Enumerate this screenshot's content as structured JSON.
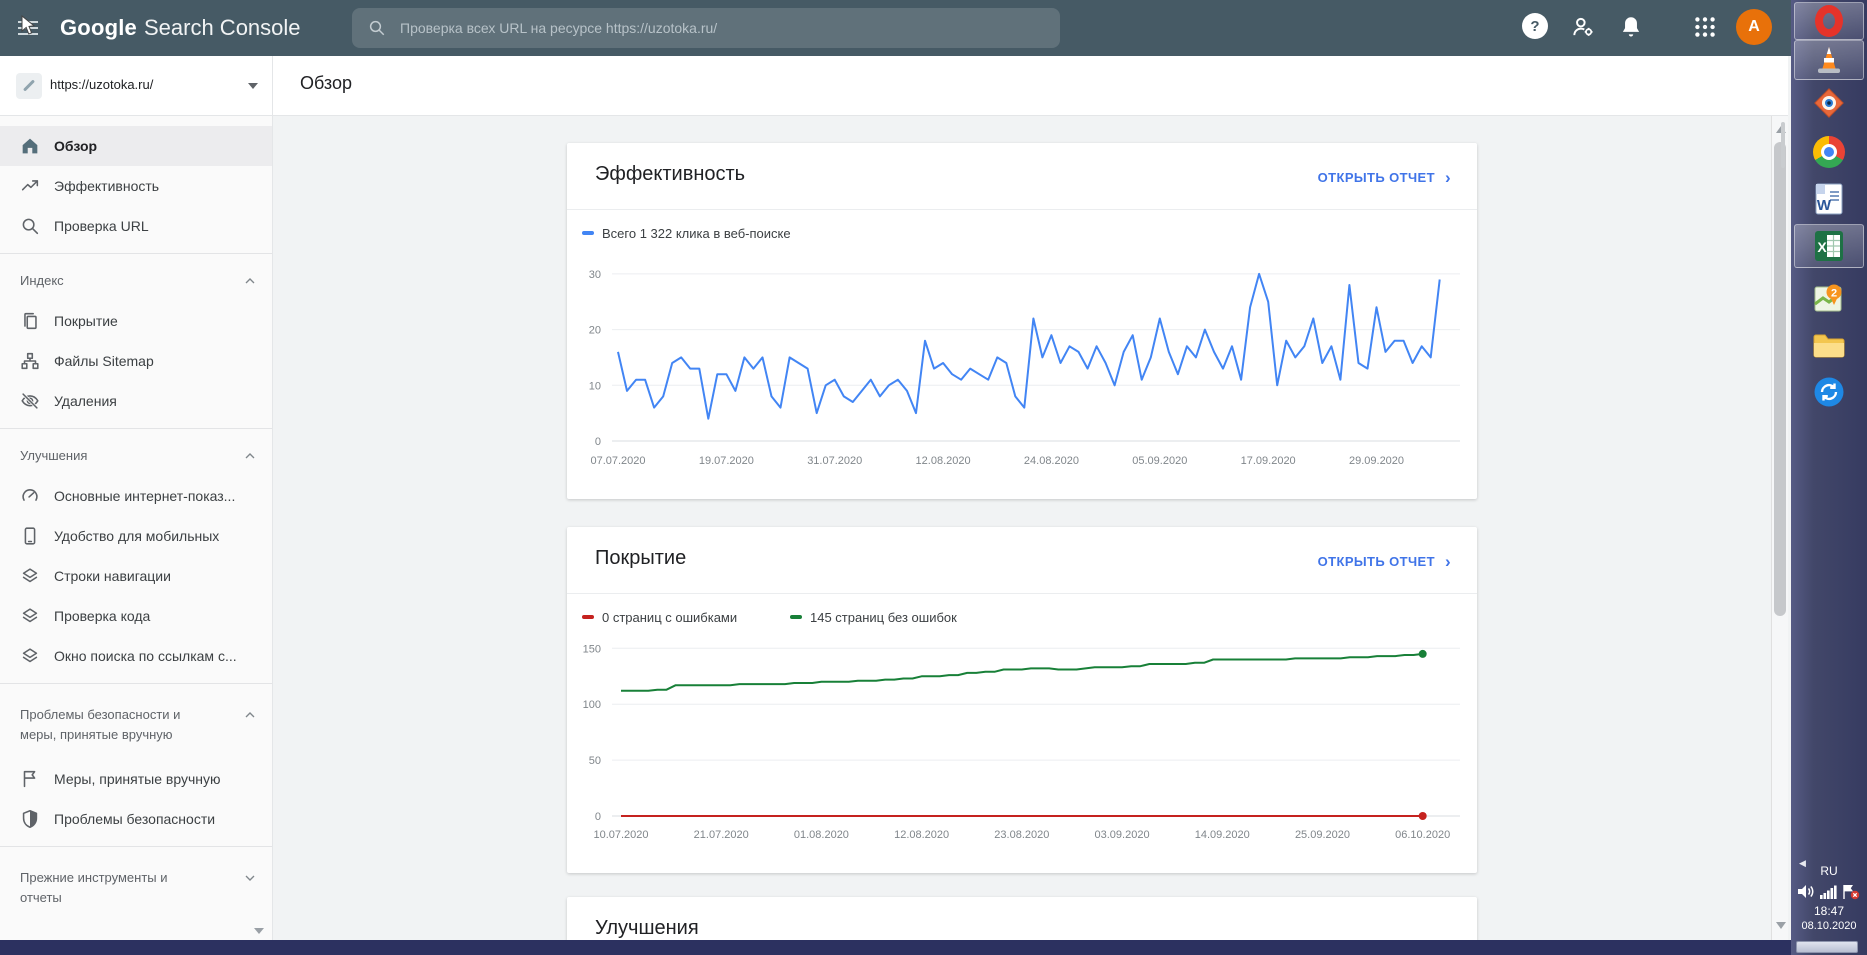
{
  "header": {
    "logo_bold": "Google",
    "logo_light": "Search Console",
    "search_placeholder": "Проверка всех URL на ресурсе https://uzotoka.ru/",
    "avatar_letter": "A",
    "help_glyph": "?"
  },
  "property_selector": {
    "url": "https://uzotoka.ru/"
  },
  "page": {
    "title": "Обзор"
  },
  "sidebar": {
    "items": [
      {
        "type": "item",
        "icon": "home-icon",
        "label": "Обзор",
        "active": true
      },
      {
        "type": "item",
        "icon": "performance-icon",
        "label": "Эффективность"
      },
      {
        "type": "item",
        "icon": "url-inspection-icon",
        "label": "Проверка URL"
      },
      {
        "type": "divider"
      },
      {
        "type": "header",
        "label": "Индекс",
        "chevron": "up"
      },
      {
        "type": "item",
        "icon": "coverage-icon",
        "label": "Покрытие"
      },
      {
        "type": "item",
        "icon": "sitemaps-icon",
        "label": "Файлы Sitemap"
      },
      {
        "type": "item",
        "icon": "removals-icon",
        "label": "Удаления"
      },
      {
        "type": "divider"
      },
      {
        "type": "header",
        "label": "Улучшения",
        "chevron": "up"
      },
      {
        "type": "item",
        "icon": "core-web-vitals-icon",
        "label": "Основные интернет-показ..."
      },
      {
        "type": "item",
        "icon": "mobile-usability-icon",
        "label": "Удобство для мобильных"
      },
      {
        "type": "item",
        "icon": "breadcrumbs-icon",
        "label": "Строки навигации"
      },
      {
        "type": "item",
        "icon": "code-check-icon",
        "label": "Проверка кода"
      },
      {
        "type": "item",
        "icon": "sitelinks-searchbox-icon",
        "label": "Окно поиска по ссылкам с..."
      },
      {
        "type": "divider"
      },
      {
        "type": "header",
        "label": "Проблемы безопасности и меры, принятые вручную",
        "chevron": "up",
        "multiline": true
      },
      {
        "type": "item",
        "icon": "manual-actions-icon",
        "label": "Меры, принятые вручную"
      },
      {
        "type": "item",
        "icon": "security-issues-icon",
        "label": "Проблемы безопасности"
      },
      {
        "type": "divider"
      },
      {
        "type": "header",
        "label": "Прежние инструменты и отчеты",
        "chevron": "down",
        "multiline": true
      }
    ]
  },
  "cards": {
    "performance": {
      "title": "Эффективность",
      "action_label": "ОТКРЫТЬ ОТЧЕТ",
      "action_chevron": "›"
    },
    "coverage": {
      "title": "Покрытие",
      "action_label": "ОТКРЫТЬ ОТЧЕТ",
      "action_chevron": "›"
    },
    "enhancements": {
      "title": "Улучшения"
    }
  },
  "chart_data": [
    {
      "type": "line",
      "title": "Эффективность",
      "legend_position": "top-left",
      "grid": true,
      "y_ticks": [
        0,
        10,
        20,
        30
      ],
      "ylim": [
        0,
        33
      ],
      "x_ticks": [
        "07.07.2020",
        "19.07.2020",
        "31.07.2020",
        "12.08.2020",
        "24.08.2020",
        "05.09.2020",
        "17.09.2020",
        "29.09.2020"
      ],
      "x_range": [
        "07.07.2020",
        "06.10.2020"
      ],
      "series": [
        {
          "name": "Всего 1 322 клика в веб-поиске",
          "color": "#4285f4",
          "total_clicks": 1322,
          "values": [
            16,
            9,
            11,
            11,
            6,
            8,
            14,
            15,
            13,
            13,
            4,
            12,
            12,
            9,
            15,
            13,
            15,
            8,
            6,
            15,
            14,
            13,
            5,
            10,
            11,
            8,
            7,
            9,
            11,
            8,
            10,
            11,
            9,
            5,
            18,
            13,
            14,
            12,
            11,
            13,
            12,
            11,
            15,
            14,
            8,
            6,
            22,
            15,
            19,
            14,
            17,
            16,
            13,
            17,
            14,
            10,
            16,
            19,
            11,
            15,
            22,
            16,
            12,
            17,
            15,
            20,
            16,
            13,
            17,
            11,
            24,
            30,
            25,
            10,
            18,
            15,
            17,
            22,
            14,
            17,
            11,
            28,
            14,
            13,
            24,
            16,
            18,
            18,
            14,
            17,
            15,
            29
          ]
        }
      ]
    },
    {
      "type": "line",
      "title": "Покрытие",
      "legend_position": "top-left",
      "grid": true,
      "y_ticks": [
        0,
        50,
        100,
        150
      ],
      "ylim": [
        0,
        160
      ],
      "x_ticks": [
        "10.07.2020",
        "21.07.2020",
        "01.08.2020",
        "12.08.2020",
        "23.08.2020",
        "03.09.2020",
        "14.09.2020",
        "25.09.2020",
        "06.10.2020"
      ],
      "x_range": [
        "10.07.2020",
        "06.10.2020"
      ],
      "series": [
        {
          "name": "0 страниц с ошибками",
          "color": "#c5221f",
          "values_constant": 0,
          "points": 89,
          "end_dot": true
        },
        {
          "name": "145 страниц без ошибок",
          "color": "#188038",
          "end_dot": true,
          "values": [
            112,
            112,
            112,
            112,
            113,
            113,
            117,
            117,
            117,
            117,
            117,
            117,
            117,
            118,
            118,
            118,
            118,
            118,
            118,
            119,
            119,
            119,
            120,
            120,
            120,
            120,
            121,
            121,
            121,
            122,
            122,
            123,
            123,
            125,
            125,
            125,
            126,
            126,
            128,
            128,
            129,
            129,
            131,
            131,
            131,
            132,
            132,
            132,
            131,
            131,
            131,
            132,
            133,
            133,
            133,
            133,
            134,
            134,
            136,
            136,
            136,
            136,
            136,
            137,
            137,
            140,
            140,
            140,
            140,
            140,
            140,
            140,
            140,
            140,
            141,
            141,
            141,
            141,
            141,
            141,
            142,
            142,
            142,
            143,
            143,
            143,
            144,
            144,
            145
          ]
        }
      ]
    }
  ],
  "taskbar": {
    "pinned_icons": [
      {
        "name": "opera-icon",
        "highlighted": true
      },
      {
        "name": "vlc-icon",
        "highlighted": true
      },
      {
        "name": "faststone-icon",
        "highlighted": false
      },
      {
        "name": "chrome-icon",
        "highlighted": false
      },
      {
        "name": "word-icon",
        "highlighted": false
      },
      {
        "name": "excel-icon",
        "highlighted": true
      },
      {
        "name": "maps-icon",
        "highlighted": false
      },
      {
        "name": "folder-icon",
        "highlighted": false
      },
      {
        "name": "sync-icon",
        "highlighted": false
      }
    ],
    "tray": {
      "language": "RU",
      "time": "18:47",
      "date": "08.10.2020",
      "hidden_icons_glyph": "◀"
    }
  },
  "colors": {
    "appbar": "#465a65",
    "accent_blue": "#4285f4",
    "link_blue": "#4074e8",
    "green": "#188038",
    "red": "#c5221f",
    "avatar_orange": "#e8710a"
  }
}
